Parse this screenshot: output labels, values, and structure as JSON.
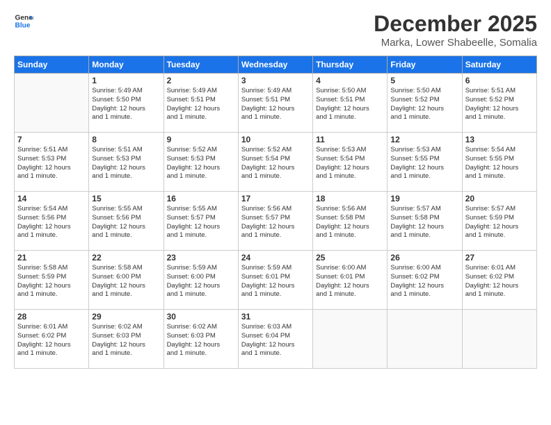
{
  "logo": {
    "line1": "General",
    "line2": "Blue"
  },
  "title": "December 2025",
  "subtitle": "Marka, Lower Shabeelle, Somalia",
  "headers": [
    "Sunday",
    "Monday",
    "Tuesday",
    "Wednesday",
    "Thursday",
    "Friday",
    "Saturday"
  ],
  "weeks": [
    [
      {
        "day": "",
        "info": ""
      },
      {
        "day": "1",
        "info": "Sunrise: 5:49 AM\nSunset: 5:50 PM\nDaylight: 12 hours\nand 1 minute."
      },
      {
        "day": "2",
        "info": "Sunrise: 5:49 AM\nSunset: 5:51 PM\nDaylight: 12 hours\nand 1 minute."
      },
      {
        "day": "3",
        "info": "Sunrise: 5:49 AM\nSunset: 5:51 PM\nDaylight: 12 hours\nand 1 minute."
      },
      {
        "day": "4",
        "info": "Sunrise: 5:50 AM\nSunset: 5:51 PM\nDaylight: 12 hours\nand 1 minute."
      },
      {
        "day": "5",
        "info": "Sunrise: 5:50 AM\nSunset: 5:52 PM\nDaylight: 12 hours\nand 1 minute."
      },
      {
        "day": "6",
        "info": "Sunrise: 5:51 AM\nSunset: 5:52 PM\nDaylight: 12 hours\nand 1 minute."
      }
    ],
    [
      {
        "day": "7",
        "info": "Sunrise: 5:51 AM\nSunset: 5:53 PM\nDaylight: 12 hours\nand 1 minute."
      },
      {
        "day": "8",
        "info": "Sunrise: 5:51 AM\nSunset: 5:53 PM\nDaylight: 12 hours\nand 1 minute."
      },
      {
        "day": "9",
        "info": "Sunrise: 5:52 AM\nSunset: 5:53 PM\nDaylight: 12 hours\nand 1 minute."
      },
      {
        "day": "10",
        "info": "Sunrise: 5:52 AM\nSunset: 5:54 PM\nDaylight: 12 hours\nand 1 minute."
      },
      {
        "day": "11",
        "info": "Sunrise: 5:53 AM\nSunset: 5:54 PM\nDaylight: 12 hours\nand 1 minute."
      },
      {
        "day": "12",
        "info": "Sunrise: 5:53 AM\nSunset: 5:55 PM\nDaylight: 12 hours\nand 1 minute."
      },
      {
        "day": "13",
        "info": "Sunrise: 5:54 AM\nSunset: 5:55 PM\nDaylight: 12 hours\nand 1 minute."
      }
    ],
    [
      {
        "day": "14",
        "info": "Sunrise: 5:54 AM\nSunset: 5:56 PM\nDaylight: 12 hours\nand 1 minute."
      },
      {
        "day": "15",
        "info": "Sunrise: 5:55 AM\nSunset: 5:56 PM\nDaylight: 12 hours\nand 1 minute."
      },
      {
        "day": "16",
        "info": "Sunrise: 5:55 AM\nSunset: 5:57 PM\nDaylight: 12 hours\nand 1 minute."
      },
      {
        "day": "17",
        "info": "Sunrise: 5:56 AM\nSunset: 5:57 PM\nDaylight: 12 hours\nand 1 minute."
      },
      {
        "day": "18",
        "info": "Sunrise: 5:56 AM\nSunset: 5:58 PM\nDaylight: 12 hours\nand 1 minute."
      },
      {
        "day": "19",
        "info": "Sunrise: 5:57 AM\nSunset: 5:58 PM\nDaylight: 12 hours\nand 1 minute."
      },
      {
        "day": "20",
        "info": "Sunrise: 5:57 AM\nSunset: 5:59 PM\nDaylight: 12 hours\nand 1 minute."
      }
    ],
    [
      {
        "day": "21",
        "info": "Sunrise: 5:58 AM\nSunset: 5:59 PM\nDaylight: 12 hours\nand 1 minute."
      },
      {
        "day": "22",
        "info": "Sunrise: 5:58 AM\nSunset: 6:00 PM\nDaylight: 12 hours\nand 1 minute."
      },
      {
        "day": "23",
        "info": "Sunrise: 5:59 AM\nSunset: 6:00 PM\nDaylight: 12 hours\nand 1 minute."
      },
      {
        "day": "24",
        "info": "Sunrise: 5:59 AM\nSunset: 6:01 PM\nDaylight: 12 hours\nand 1 minute."
      },
      {
        "day": "25",
        "info": "Sunrise: 6:00 AM\nSunset: 6:01 PM\nDaylight: 12 hours\nand 1 minute."
      },
      {
        "day": "26",
        "info": "Sunrise: 6:00 AM\nSunset: 6:02 PM\nDaylight: 12 hours\nand 1 minute."
      },
      {
        "day": "27",
        "info": "Sunrise: 6:01 AM\nSunset: 6:02 PM\nDaylight: 12 hours\nand 1 minute."
      }
    ],
    [
      {
        "day": "28",
        "info": "Sunrise: 6:01 AM\nSunset: 6:02 PM\nDaylight: 12 hours\nand 1 minute."
      },
      {
        "day": "29",
        "info": "Sunrise: 6:02 AM\nSunset: 6:03 PM\nDaylight: 12 hours\nand 1 minute."
      },
      {
        "day": "30",
        "info": "Sunrise: 6:02 AM\nSunset: 6:03 PM\nDaylight: 12 hours\nand 1 minute."
      },
      {
        "day": "31",
        "info": "Sunrise: 6:03 AM\nSunset: 6:04 PM\nDaylight: 12 hours\nand 1 minute."
      },
      {
        "day": "",
        "info": ""
      },
      {
        "day": "",
        "info": ""
      },
      {
        "day": "",
        "info": ""
      }
    ]
  ]
}
